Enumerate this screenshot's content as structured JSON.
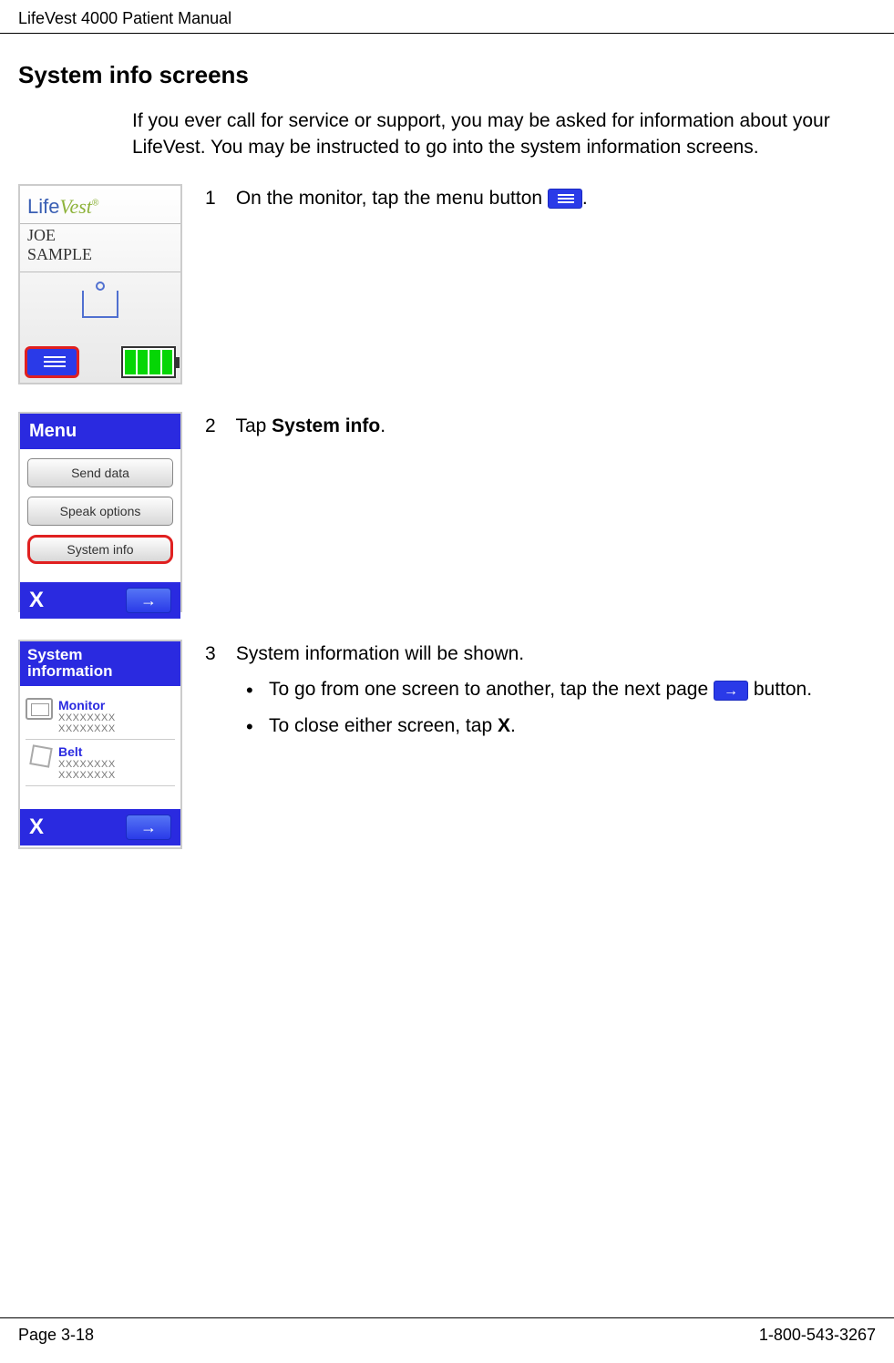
{
  "header": {
    "title": "LifeVest 4000 Patient Manual"
  },
  "section": {
    "title": "System info screens"
  },
  "intro": "If you ever call for service or support, you may be asked for information about your LifeVest. You may be instructed to go into the system information screens.",
  "steps": {
    "s1": {
      "num": "1",
      "text_before": "On the monitor, tap the menu button ",
      "text_after": "."
    },
    "s2": {
      "num": "2",
      "text_a": "Tap ",
      "bold": "System info",
      "text_b": "."
    },
    "s3": {
      "num": "3",
      "text": "System information will be shown.",
      "b1_a": "To go from one screen to another, tap the next page ",
      "b1_b": " button.",
      "b2_a": "To close either screen, tap ",
      "b2_bold": "X",
      "b2_b": "."
    }
  },
  "device1": {
    "logo_a": "Life",
    "logo_b": "Vest",
    "logo_reg": "®",
    "name_line1": "JOE",
    "name_line2": "SAMPLE"
  },
  "device2": {
    "header": "Menu",
    "opt1": "Send data",
    "opt2": "Speak options",
    "opt3": "System info",
    "close": "X",
    "next": "→"
  },
  "device3": {
    "header_line1": "System",
    "header_line2": "information",
    "monitor_label": "Monitor",
    "monitor_val1": "XXXXXXXX",
    "monitor_val2": "XXXXXXXX",
    "belt_label": "Belt",
    "belt_val1": "XXXXXXXX",
    "belt_val2": "XXXXXXXX",
    "close": "X",
    "next": "→"
  },
  "footer": {
    "page": "Page 3-18",
    "phone": "1-800-543-3267"
  }
}
